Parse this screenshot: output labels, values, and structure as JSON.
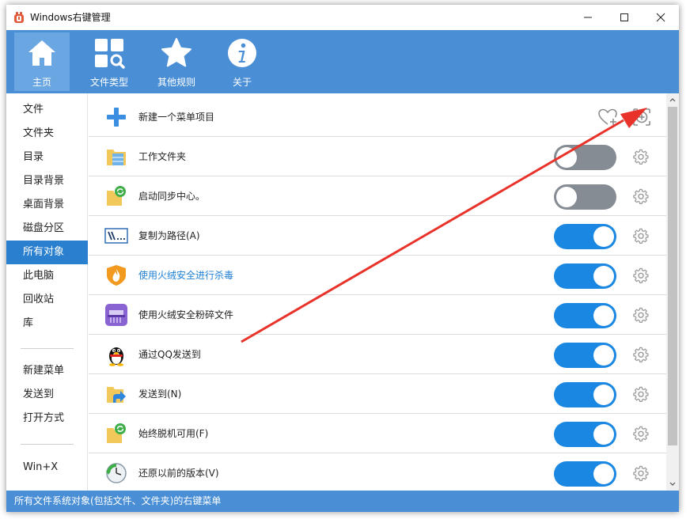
{
  "window": {
    "title": "Windows右键管理"
  },
  "toolbar": [
    {
      "id": "home",
      "label": "主页",
      "icon": "home-icon",
      "active": true
    },
    {
      "id": "filetypes",
      "label": "文件类型",
      "icon": "grid-search-icon",
      "active": false
    },
    {
      "id": "rules",
      "label": "其他规则",
      "icon": "star-icon",
      "active": false
    },
    {
      "id": "about",
      "label": "关于",
      "icon": "info-icon",
      "active": false
    }
  ],
  "sidebar": {
    "groups": [
      [
        "文件",
        "文件夹",
        "目录",
        "目录背景",
        "桌面背景",
        "磁盘分区",
        "所有对象",
        "此电脑",
        "回收站",
        "库"
      ],
      [
        "新建菜单",
        "发送到",
        "打开方式"
      ],
      [
        "Win+X"
      ]
    ],
    "selected": "所有对象"
  },
  "new_item": {
    "label": "新建一个菜单项目"
  },
  "rows": [
    {
      "label": "工作文件夹",
      "icon": "work-folder-icon",
      "enabled": false,
      "link": false
    },
    {
      "label": "启动同步中心。",
      "icon": "sync-center-icon",
      "enabled": false,
      "link": false
    },
    {
      "label": "复制为路径(A)",
      "icon": "copy-path-icon",
      "enabled": true,
      "link": false
    },
    {
      "label": "使用火绒安全进行杀毒",
      "icon": "huorong-shield-icon",
      "enabled": true,
      "link": true
    },
    {
      "label": "使用火绒安全粉碎文件",
      "icon": "shredder-icon",
      "enabled": true,
      "link": false
    },
    {
      "label": "通过QQ发送到",
      "icon": "qq-penguin-icon",
      "enabled": true,
      "link": false
    },
    {
      "label": "发送到(N)",
      "icon": "send-to-icon",
      "enabled": true,
      "link": false
    },
    {
      "label": "始终脱机可用(F)",
      "icon": "offline-sync-icon",
      "enabled": true,
      "link": false
    },
    {
      "label": "还原以前的版本(V)",
      "icon": "restore-clock-icon",
      "enabled": true,
      "link": false
    }
  ],
  "status": {
    "text": "所有文件系统对象(包括文件、文件夹)的右键菜单"
  },
  "colors": {
    "accent": "#4a8fd6",
    "selected": "#2a7fcf",
    "toggle_on": "#1a88e2",
    "toggle_off": "#858c93",
    "arrow": "#e8322a",
    "link": "#1f7fd4"
  }
}
